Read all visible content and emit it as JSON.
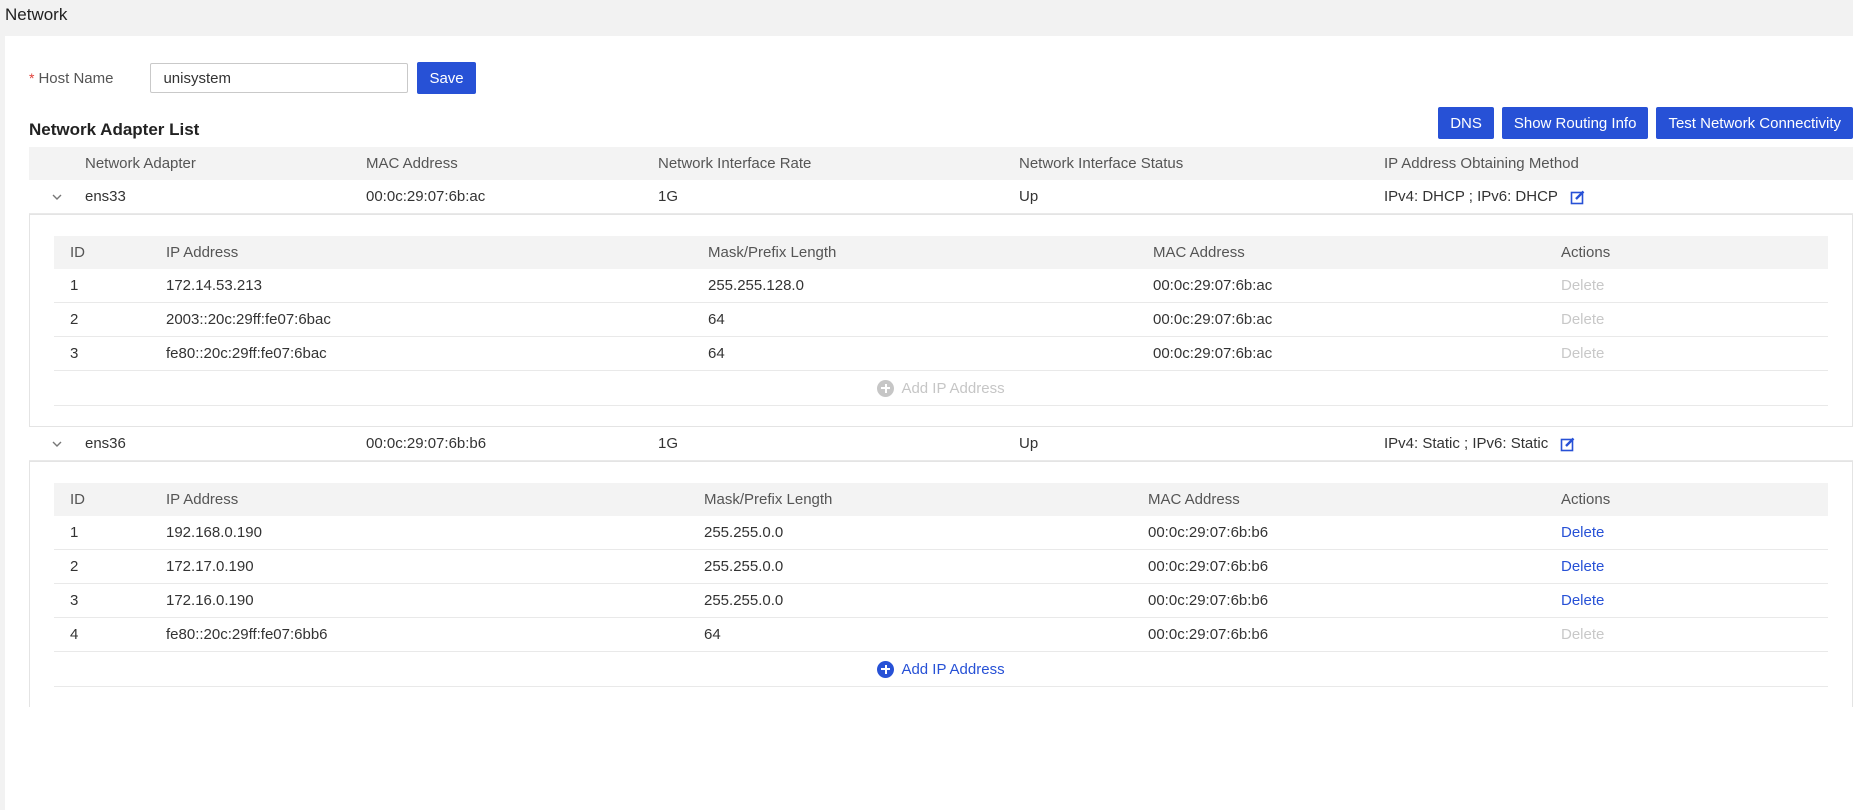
{
  "page": {
    "title": "Network"
  },
  "host": {
    "label": "Host Name",
    "required_mark": "*",
    "value": "unisystem",
    "save_label": "Save"
  },
  "adapters_section": {
    "title": "Network Adapter List",
    "buttons": {
      "dns": "DNS",
      "routing": "Show Routing Info",
      "test": "Test Network Connectivity"
    },
    "columns": [
      "Network Adapter",
      "MAC Address",
      "Network Interface Rate",
      "Network Interface Status",
      "IP Address Obtaining Method"
    ],
    "sub_columns": [
      "ID",
      "IP Address",
      "Mask/Prefix Length",
      "MAC Address",
      "Actions"
    ],
    "add_ip_label": "Add IP Address",
    "delete_label": "Delete",
    "adapters": [
      {
        "name": "ens33",
        "mac": "00:0c:29:07:6b:ac",
        "rate": "1G",
        "status": "Up",
        "method": "IPv4: DHCP ; IPv6: DHCP",
        "ips": [
          {
            "id": "1",
            "ip": "172.14.53.213",
            "mask": "255.255.128.0",
            "mac": "00:0c:29:07:6b:ac"
          },
          {
            "id": "2",
            "ip": "2003::20c:29ff:fe07:6bac",
            "mask": "64",
            "mac": "00:0c:29:07:6b:ac"
          },
          {
            "id": "3",
            "ip": "fe80::20c:29ff:fe07:6bac",
            "mask": "64",
            "mac": "00:0c:29:07:6b:ac"
          }
        ]
      },
      {
        "name": "ens36",
        "mac": "00:0c:29:07:6b:b6",
        "rate": "1G",
        "status": "Up",
        "method": "IPv4: Static ; IPv6: Static",
        "ips": [
          {
            "id": "1",
            "ip": "192.168.0.190",
            "mask": "255.255.0.0",
            "mac": "00:0c:29:07:6b:b6"
          },
          {
            "id": "2",
            "ip": "172.17.0.190",
            "mask": "255.255.0.0",
            "mac": "00:0c:29:07:6b:b6"
          },
          {
            "id": "3",
            "ip": "172.16.0.190",
            "mask": "255.255.0.0",
            "mac": "00:0c:29:07:6b:b6"
          },
          {
            "id": "4",
            "ip": "fe80::20c:29ff:fe07:6bb6",
            "mask": "64",
            "mac": "00:0c:29:07:6b:b6"
          }
        ]
      }
    ]
  },
  "colors": {
    "primary": "#2751d6",
    "disabled": "#c8c8c8",
    "header_bg": "#f3f3f3"
  }
}
